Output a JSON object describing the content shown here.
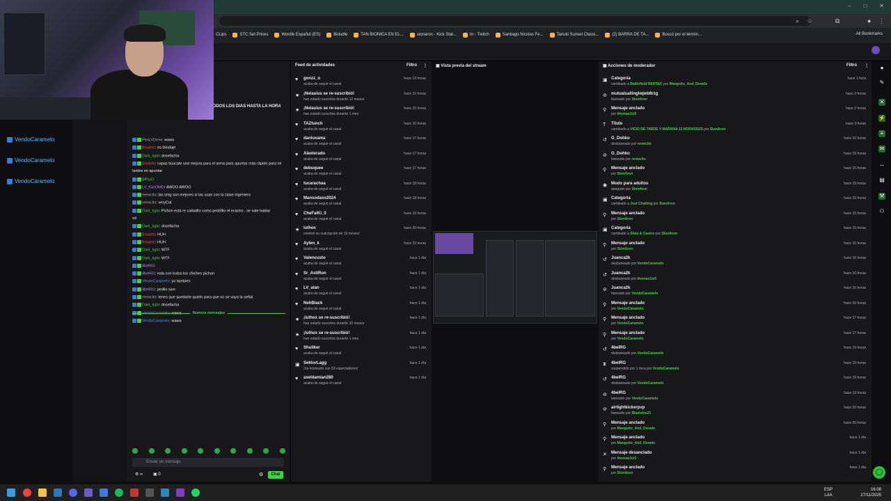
{
  "browser": {
    "bookmarks": [
      "CLips",
      "STC Set Prices",
      "Wordle Español (ES)",
      "Boludle",
      "TAN BIONICA EN EL...",
      "sionaron - Kick Stat...",
      "trr - Twitch",
      "Santiago Nicolas Fe...",
      "Tanuki Sunset Classi...",
      "(2) BARRA DE TA...",
      "Buscó por el términ..."
    ],
    "all_bookmarks": "All Bookmarks"
  },
  "left": {
    "mini_users": [
      "VendoCaramelo",
      "VendoCaramelo",
      "VendoCaramelo"
    ],
    "chat_label": "Chat"
  },
  "chat": {
    "pinned_text": "TODOS LOS DIAS HASTA LA HORA",
    "lines": [
      {
        "user": "PeoLVDrew",
        "text": ": wawa",
        "color": "n-gr"
      },
      {
        "user": "Brsanto",
        "text": ": es blindaje",
        "color": "n-red"
      },
      {
        "user": "Dark_kgbc",
        "text": " dosefacha",
        "color": "n-green"
      },
      {
        "user": "Brsanto",
        "text": ": capas búscate una mejora para el arma para apuntar más rápido para mi",
        "color": "n-red"
      },
      {
        "user": "",
        "text": "tardes en apuntar",
        "color": "n-gr"
      },
      {
        "user": "BPhyO",
        "text": "",
        "color": "n-green"
      },
      {
        "user": "LV_KazOMDr",
        "text": " AWOO AWOO",
        "color": "n-pur"
      },
      {
        "user": "reewcito",
        "text": ": las smg son mejores si las usas con la clase ingeniero",
        "color": "n-gr"
      },
      {
        "user": "reewcito",
        "text": ": veryCat",
        "color": "n-gr"
      },
      {
        "user": "Dark_kgbc",
        "text": " Pichón esta re calladito como pedófilo el ecacho , se vale hablar",
        "color": "n-green"
      },
      {
        "user": "",
        "text": "xd",
        "color": "n-gr"
      },
      {
        "user": "Dark_kgbc",
        "text": " dosefacha",
        "color": "n-green"
      },
      {
        "user": "Brsanto",
        "text": ": HUH",
        "color": "n-red"
      },
      {
        "user": "Brsanto",
        "text": ": HUH",
        "color": "n-red"
      },
      {
        "user": "Dark_kgbc",
        "text": " WTF",
        "color": "n-green"
      },
      {
        "user": "Dark_kgbc",
        "text": " WTF",
        "color": "n-green"
      },
      {
        "user": "4belRG",
        "text": "",
        "color": "n-pur"
      },
      {
        "user": "4belRG",
        "text": ": esta con todos los chiches pichon",
        "color": "n-pur"
      },
      {
        "user": "VendoCaramelo",
        "text": ": yo tambien",
        "color": "n-blue"
      },
      {
        "user": "4belRG",
        "text": ": pedilo sion",
        "color": "n-pur"
      },
      {
        "user": "reewcito",
        "text": ": tenes que quedarte quieto para que no se vaya la señal",
        "color": "n-gr"
      },
      {
        "user": "Dark_kgbc",
        "text": " dosefacha",
        "color": "n-green"
      },
      {
        "user": "VendoCaramelo",
        "text": ": wawa",
        "color": "n-blue"
      }
    ],
    "nuevos": "Nuevos mensajes",
    "after_new": {
      "user": "VendoCaramelo",
      "text": ": wawa"
    },
    "input_placeholder": "Enviar un mensaje",
    "points": "0",
    "send": "Chat"
  },
  "feed": {
    "title": "Feed de actividades",
    "filter": "Filtro",
    "items": [
      {
        "name": "gonzz_o",
        "sub": "acaba de seguir el canal",
        "time": "hace 13 horas",
        "icon": "heart"
      },
      {
        "name": "¡Nelasius se re-suscribió!",
        "sub": "han estado suscritos durante 12 meses",
        "time": "hace 15 horas",
        "icon": "star"
      },
      {
        "name": "¡Nelasius se re-suscribió!",
        "sub": "han estado suscritos durante 1 mes",
        "time": "hace 15 horas",
        "icon": "star"
      },
      {
        "name": "TAZtunch",
        "sub": "acaba de seguir el canal",
        "time": "hace 16 horas",
        "icon": "heart"
      },
      {
        "name": "danluxama",
        "sub": "acaba de seguir el canal",
        "time": "hace 17 horas",
        "icon": "heart"
      },
      {
        "name": "Aleeterado",
        "sub": "acaba de seguir el canal",
        "time": "hace 17 horas",
        "icon": "heart"
      },
      {
        "name": "debuquee",
        "sub": "acaba de seguir el canal",
        "time": "hace 17 horas",
        "icon": "heart"
      },
      {
        "name": "tucarachaa",
        "sub": "acaba de seguir el canal",
        "time": "hace 18 horas",
        "icon": "heart"
      },
      {
        "name": "Mansodaso2024",
        "sub": "acaba de seguir el canal",
        "time": "hace 18 horas",
        "icon": "heart"
      },
      {
        "name": "CheFaiKi_0",
        "sub": "acaba de seguir el canal",
        "time": "hace 19 horas",
        "icon": "heart"
      },
      {
        "name": "luthox",
        "sub": "celebró su suscripción de 16 meses!",
        "time": "hace 20 horas",
        "icon": "star"
      },
      {
        "name": "Aylen_k",
        "sub": "acaba de seguir el canal",
        "time": "hace 23 horas",
        "icon": "heart"
      },
      {
        "name": "Valencusto",
        "sub": "acaba de seguir el canal",
        "time": "hace 1 día",
        "icon": "heart"
      },
      {
        "name": "Sr_AstiRon",
        "sub": "acaba de seguir el canal",
        "time": "hace 1 día",
        "icon": "heart"
      },
      {
        "name": "LV_alan",
        "sub": "acaba de seguir el canal",
        "time": "hace 1 día",
        "icon": "heart"
      },
      {
        "name": "NehBlack",
        "sub": "acaba de seguir el canal",
        "time": "hace 1 día",
        "icon": "heart"
      },
      {
        "name": "¡luthox se re-suscribió!",
        "sub": "han estado suscritos durante 10 meses",
        "time": "hace 1 día",
        "icon": "star"
      },
      {
        "name": "¡luthox se re-suscribió!",
        "sub": "han estado suscritos durante 1 mes",
        "time": "hace 1 día",
        "icon": "star"
      },
      {
        "name": "Shuliker",
        "sub": "acaba de seguir el canal",
        "time": "hace 1 día",
        "icon": "heart"
      },
      {
        "name": "SektorLagg",
        "sub": "¡ha hosteado con 53 espectadores!",
        "time": "hace 1 día",
        "icon": "host"
      },
      {
        "name": "axeldamian280",
        "sub": "acaba de seguir el canal",
        "time": "hace 1 día",
        "icon": "heart"
      }
    ]
  },
  "preview": {
    "title": "Vista previa del stream"
  },
  "mod": {
    "title": "Acciones de moderador",
    "filter": "Filtro",
    "items": [
      {
        "name": "Categoría",
        "pre": "cambiado a ",
        "a": "Battlefield REDSEC",
        "mid": " por ",
        "b": "Manguito_And_Dreads",
        "time": "hace 1 hora",
        "icon": "cat"
      },
      {
        "name": "mutualsailinglwjwb8rzg",
        "pre": "baneado ",
        "a": "",
        "mid": "por ",
        "b": "SionAron",
        "time": "hace 2 horas",
        "icon": "ban"
      },
      {
        "name": "Mensaje anclado",
        "pre": "",
        "a": "",
        "mid": "por ",
        "b": "thomas1tz5",
        "time": "hace 2 horas",
        "icon": "pin"
      },
      {
        "name": "Título",
        "pre": "cambiado a ",
        "a": "VICIO DE TARDE Y MAÑANA 12 HORASSSS",
        "mid": " por ",
        "b": "SionAron",
        "time": "hace 3 horas",
        "icon": "title"
      },
      {
        "name": "G_Dohko",
        "pre": "desbaneado por ",
        "a": "",
        "mid": "",
        "b": "reewcito",
        "time": "hace 15 horas",
        "icon": "unban"
      },
      {
        "name": "G_Dohko",
        "pre": "baneado por ",
        "a": "",
        "mid": "",
        "b": "reewcito",
        "time": "hace 15 horas",
        "icon": "ban"
      },
      {
        "name": "Mensaje anclado",
        "pre": "",
        "a": "",
        "mid": "por ",
        "b": "SionAron",
        "time": "hace 15 horas",
        "icon": "pin"
      },
      {
        "name": "Modo para adultos",
        "pre": "apagado por ",
        "a": "",
        "mid": "",
        "b": "SionAron",
        "time": "hace 15 horas",
        "icon": "eye"
      },
      {
        "name": "Categoría",
        "pre": "cambiado a ",
        "a": "Just Chatting",
        "mid": " por ",
        "b": "SionAron",
        "time": "hace 15 horas",
        "icon": "cat"
      },
      {
        "name": "Mensaje anclado",
        "pre": "",
        "a": "",
        "mid": "por ",
        "b": "SionAron",
        "time": "hace 15 horas",
        "icon": "pin"
      },
      {
        "name": "Categoría",
        "pre": "cambiado a ",
        "a": "Slots & Casino",
        "mid": " por ",
        "b": "SionAron",
        "time": "hace 15 horas",
        "icon": "cat"
      },
      {
        "name": "Mensaje anclado",
        "pre": "",
        "a": "",
        "mid": "por ",
        "b": "SionAron",
        "time": "hace 16 horas",
        "icon": "pin"
      },
      {
        "name": "Juanca2k",
        "pre": "desbaneado por ",
        "a": "",
        "mid": "",
        "b": "VendoCaramelo",
        "time": "hace 16 horas",
        "icon": "unban"
      },
      {
        "name": "Juanca2k",
        "pre": "desbaneado por ",
        "a": "",
        "mid": "",
        "b": "thomas1tz5",
        "time": "hace 16 horas",
        "icon": "unban"
      },
      {
        "name": "Juanca2k",
        "pre": "baneado por ",
        "a": "",
        "mid": "",
        "b": "VendoCaramelo",
        "time": "hace 16 horas",
        "icon": "ban"
      },
      {
        "name": "Mensaje anclado",
        "pre": "",
        "a": "",
        "mid": "por ",
        "b": "VendoCaramelo",
        "time": "hace 16 horas",
        "icon": "pin"
      },
      {
        "name": "Mensaje anclado",
        "pre": "",
        "a": "",
        "mid": "por ",
        "b": "VendoCaramelo",
        "time": "hace 17 horas",
        "icon": "pin"
      },
      {
        "name": "Mensaje anclado",
        "pre": "",
        "a": "",
        "mid": "por ",
        "b": "VendoCaramelo",
        "time": "hace 17 horas",
        "icon": "pin"
      },
      {
        "name": "4belRG",
        "pre": "desbaneado por ",
        "a": "",
        "mid": "",
        "b": "VendoCaramelo",
        "time": "hace 19 horas",
        "icon": "unban"
      },
      {
        "name": "4belRG",
        "pre": "suspendido por 1 hora por ",
        "a": "",
        "mid": "",
        "b": "VendoCaramelo",
        "time": "hace 19 horas",
        "icon": "timeout"
      },
      {
        "name": "4belRG",
        "pre": "desbaneado por ",
        "a": "",
        "mid": "",
        "b": "VendoCaramelo",
        "time": "hace 19 horas",
        "icon": "unban"
      },
      {
        "name": "4belRG",
        "pre": "baneado por ",
        "a": "",
        "mid": "",
        "b": "VendoCaramelo",
        "time": "hace 19 horas",
        "icon": "ban"
      },
      {
        "name": "airtightkickerpvp",
        "pre": "baneado por ",
        "a": "",
        "mid": "",
        "b": "Blastoise21",
        "time": "hace 20 horas",
        "icon": "ban"
      },
      {
        "name": "Mensaje anclado",
        "pre": "",
        "a": "",
        "mid": "por ",
        "b": "Manguito_And_Dreads",
        "time": "hace 20 horas",
        "icon": "pin"
      },
      {
        "name": "Mensaje anclado",
        "pre": "",
        "a": "",
        "mid": "por ",
        "b": "Manguito_And_Dreads",
        "time": "hace 1 día",
        "icon": "pin"
      },
      {
        "name": "Mensaje desanclado",
        "pre": "",
        "a": "",
        "mid": "por ",
        "b": "thomas1tz5",
        "time": "hace 1 día",
        "icon": "unpin"
      },
      {
        "name": "Mensaje anclado",
        "pre": "",
        "a": "",
        "mid": "por ",
        "b": "SionAron",
        "time": "hace 1 día",
        "icon": "pin"
      }
    ]
  },
  "taskbar": {
    "lang1": "ESP",
    "lang2": "LAA",
    "time": "16:08",
    "date": "27/11/2025"
  },
  "colors": {
    "accent": "#47d147",
    "bg": "#18181b"
  }
}
